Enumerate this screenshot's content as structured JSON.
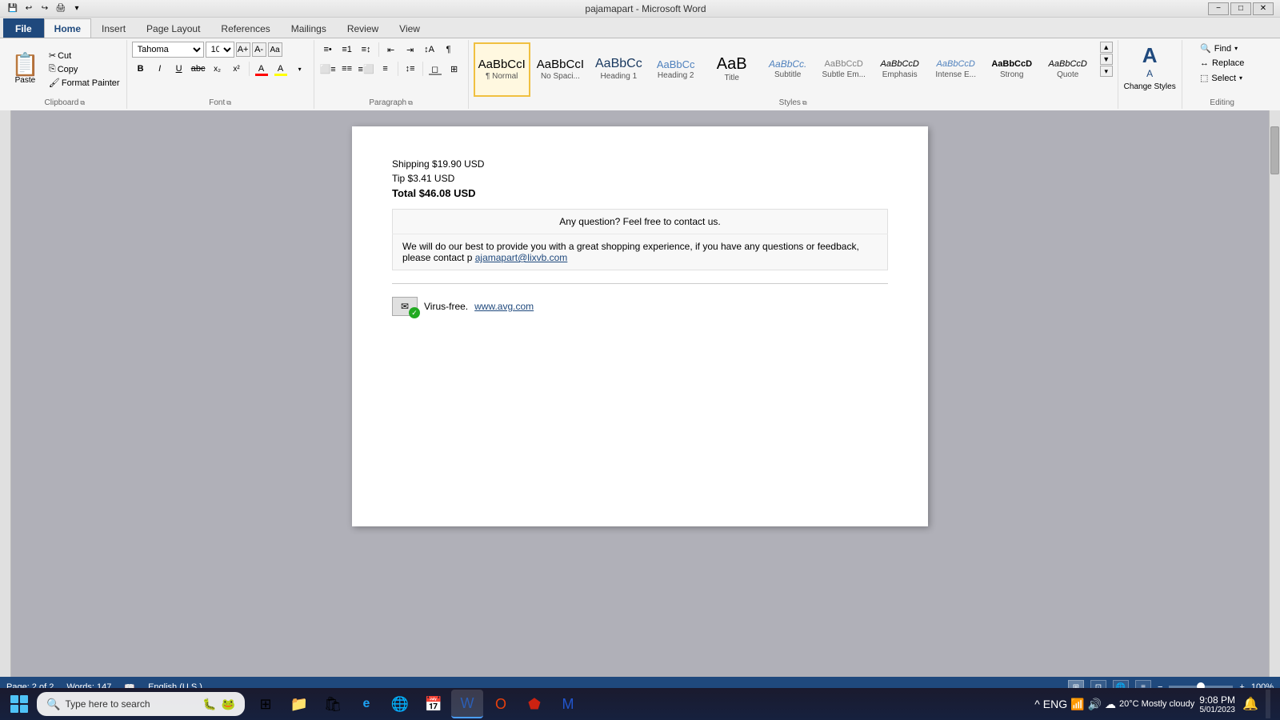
{
  "titleBar": {
    "title": "pajamapart - Microsoft Word",
    "minimize": "−",
    "maximize": "□",
    "close": "✕"
  },
  "ribbonTabs": [
    {
      "id": "file",
      "label": "File",
      "active": false,
      "isFile": true
    },
    {
      "id": "home",
      "label": "Home",
      "active": true
    },
    {
      "id": "insert",
      "label": "Insert"
    },
    {
      "id": "pageLayout",
      "label": "Page Layout"
    },
    {
      "id": "references",
      "label": "References"
    },
    {
      "id": "mailings",
      "label": "Mailings"
    },
    {
      "id": "review",
      "label": "Review"
    },
    {
      "id": "view",
      "label": "View"
    }
  ],
  "ribbon": {
    "clipboard": {
      "groupLabel": "Clipboard",
      "pasteLabel": "Paste",
      "cutLabel": "Cut",
      "copyLabel": "Copy",
      "formatPainterLabel": "Format Painter"
    },
    "font": {
      "groupLabel": "Font",
      "fontName": "Tahoma",
      "fontSize": "10",
      "boldLabel": "B",
      "italicLabel": "I",
      "underlineLabel": "U",
      "strikeLabel": "abc",
      "subLabel": "x₂",
      "supLabel": "x²",
      "clearLabel": "A"
    },
    "paragraph": {
      "groupLabel": "Paragraph"
    },
    "styles": {
      "groupLabel": "Styles",
      "items": [
        {
          "label": "¶ Normal",
          "preview": "AaBbCcI",
          "selected": true
        },
        {
          "label": "No Spaci...",
          "preview": "AaBbCcI"
        },
        {
          "label": "Heading 1",
          "preview": "AaBbCc"
        },
        {
          "label": "Heading 2",
          "preview": "AaBbCc"
        },
        {
          "label": "Title",
          "preview": "AaB"
        },
        {
          "label": "Subtitle",
          "preview": "AaBbCc."
        },
        {
          "label": "Subtle Em...",
          "preview": "AaBbCcD"
        },
        {
          "label": "Emphasis",
          "preview": "AaBbCcD"
        },
        {
          "label": "Intense E...",
          "preview": "AaBbCcD"
        },
        {
          "label": "Strong",
          "preview": "AaBbCcD"
        },
        {
          "label": "Quote",
          "preview": "AaBbCcD"
        }
      ]
    },
    "editing": {
      "groupLabel": "Editing",
      "findLabel": "Find",
      "replaceLabel": "Replace",
      "selectLabel": "Select"
    },
    "changeStyles": {
      "label": "Change Styles"
    }
  },
  "document": {
    "shipping": "Shipping $19.90 USD",
    "tip": "Tip $3.41 USD",
    "total": "Total $46.08 USD",
    "question": "Any question? Feel free to contact us.",
    "contactText": "We will do our best to provide you with a great shopping experience, if you have any questions or feedback, please contact p",
    "email": "ajamapart@lixvb.com",
    "virusFree": "Virus-free.",
    "avgLink": "www.avg.com"
  },
  "statusBar": {
    "pageInfo": "Page: 2 of 2",
    "wordCount": "Words: 147",
    "language": "English (U.S.)",
    "zoom": "100%"
  },
  "taskbar": {
    "searchPlaceholder": "Type here to search",
    "clock": {
      "time": "9:08 PM",
      "date": "5/01/2023"
    },
    "language": "ENG",
    "temperature": "20°C  Mostly cloudy"
  }
}
